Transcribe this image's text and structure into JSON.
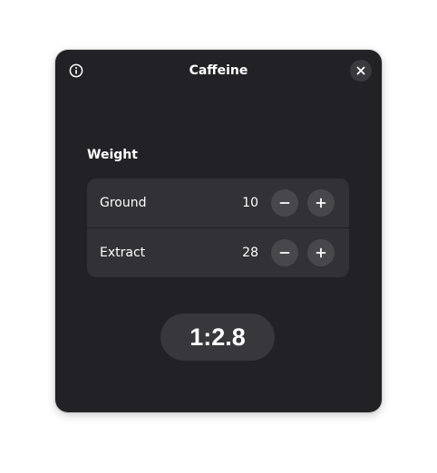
{
  "window": {
    "title": "Caffeine"
  },
  "header": {
    "info_icon": "info-icon",
    "close_icon": "close-icon"
  },
  "weight": {
    "section_title": "Weight",
    "rows": [
      {
        "label": "Ground",
        "value": "10",
        "decrement_icon": "minus-icon",
        "increment_icon": "plus-icon"
      },
      {
        "label": "Extract",
        "value": "28",
        "decrement_icon": "minus-icon",
        "increment_icon": "plus-icon"
      }
    ]
  },
  "ratio": {
    "value": "1:2.8"
  },
  "colors": {
    "window_bg": "#222226",
    "list_bg": "#323236",
    "button_bg": "#48484c",
    "ratio_bg": "#38383c",
    "text": "#ffffff"
  }
}
